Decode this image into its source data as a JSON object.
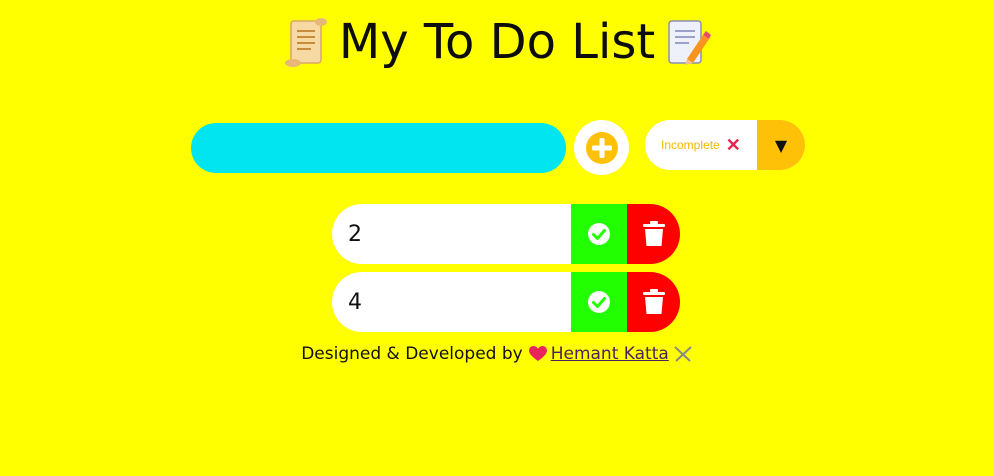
{
  "header": {
    "title": "My To Do List",
    "left_icon": "scroll-icon",
    "right_icon": "memo-icon"
  },
  "form": {
    "input_value": "",
    "add_icon": "plus-circle-icon",
    "filter_selected": "Incomplete",
    "filter_clear_icon": "close-icon",
    "filter_dropdown_icon": "caret-down-icon"
  },
  "todos": [
    {
      "text": "2"
    },
    {
      "text": "4"
    }
  ],
  "footer": {
    "prefix": "Designed & Developed by",
    "author": "Hemant Katta",
    "heart_icon": "heart-icon",
    "swords_icon": "crossed-swords-icon"
  },
  "colors": {
    "background": "#ffff00",
    "input": "#00e5f0",
    "accent": "#ffc107",
    "complete": "#22ff00",
    "delete": "#ff0000"
  }
}
